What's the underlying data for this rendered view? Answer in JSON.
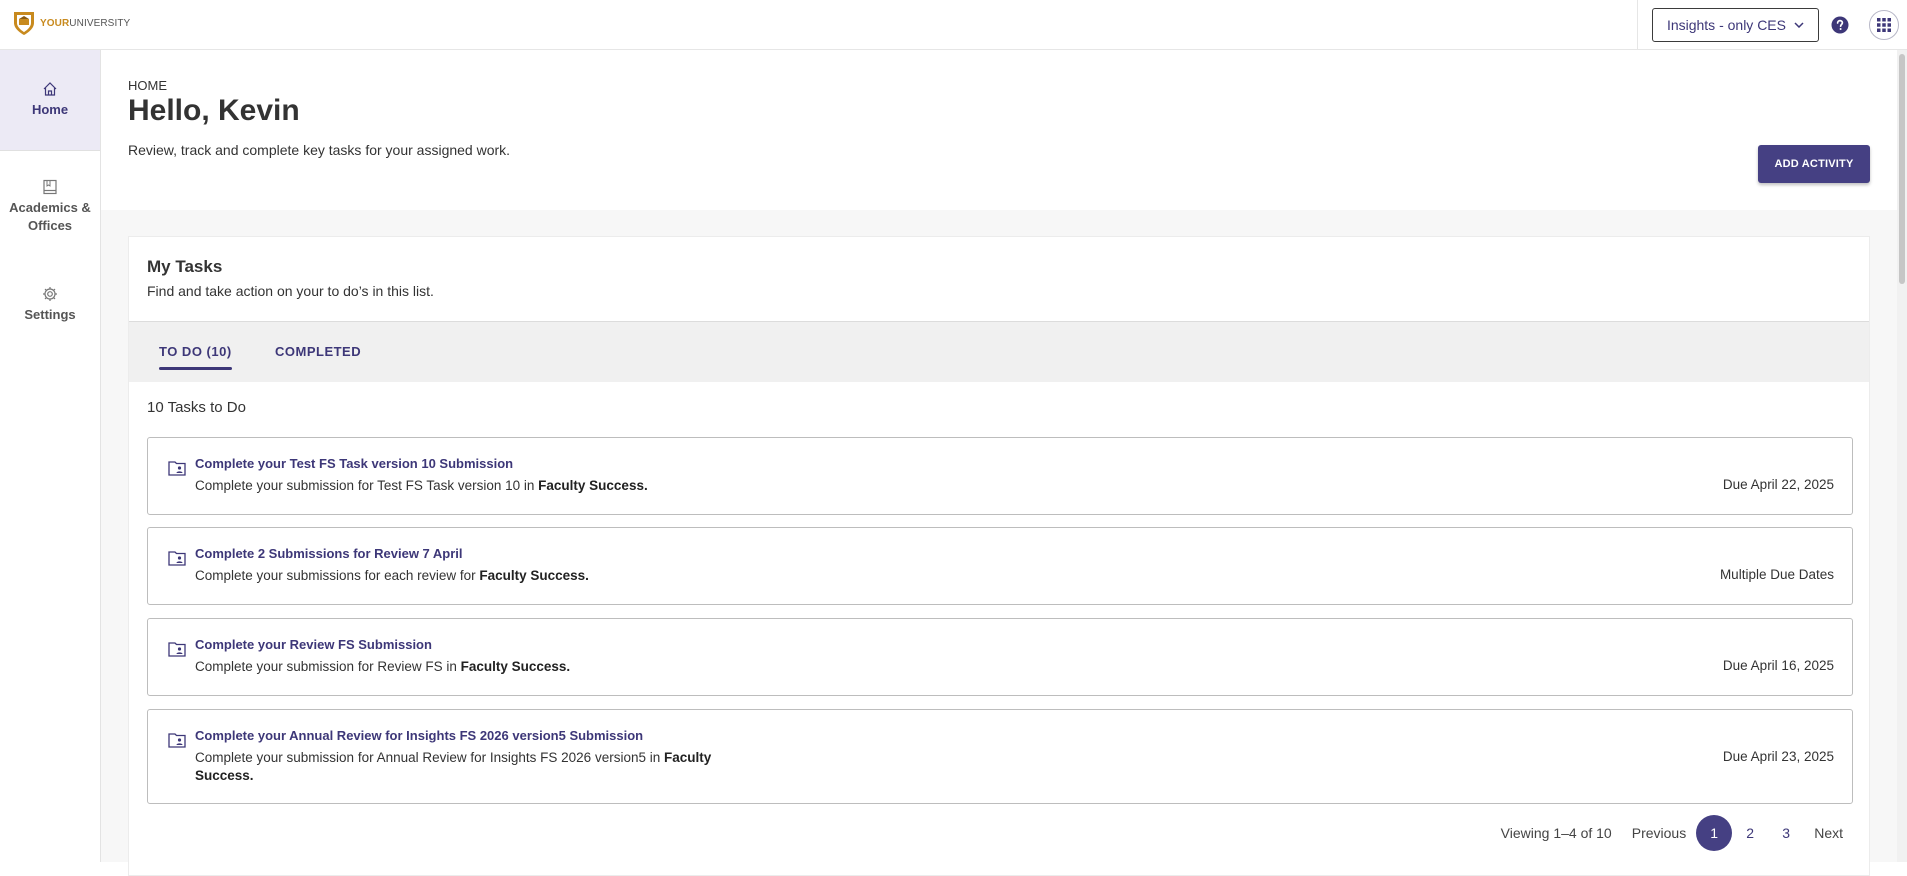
{
  "brand": {
    "prefix": "YOUR",
    "suffix": "UNIVERSITY",
    "color": "#c88a1e"
  },
  "topbar": {
    "selector_label": "Insights - only CES",
    "help_icon": "help-circle-icon",
    "apps_icon": "grid-menu-icon"
  },
  "sidebar": {
    "items": [
      {
        "label": "Home",
        "icon": "home-icon",
        "active": true
      },
      {
        "label": "Academics & Offices",
        "icon": "book-icon",
        "active": false
      },
      {
        "label": "Settings",
        "icon": "gear-icon",
        "active": false
      }
    ]
  },
  "header": {
    "breadcrumb": "HOME",
    "title": "Hello, Kevin",
    "subtitle": "Review, track and complete key tasks for your assigned work.",
    "add_button": "ADD ACTIVITY"
  },
  "tasks_card": {
    "title": "My Tasks",
    "subtitle": "Find and take action on your to do’s in this list.",
    "tabs": [
      {
        "label": "TO DO (10)",
        "active": true
      },
      {
        "label": "COMPLETED",
        "active": false
      }
    ],
    "count_label": "10 Tasks to Do",
    "items": [
      {
        "title": "Complete your Test FS Task version 10 Submission",
        "desc_prefix": "Complete your submission for Test FS Task version 10 in ",
        "desc_bold": "Faculty Success.",
        "due": "Due April 22, 2025"
      },
      {
        "title": "Complete 2 Submissions for Review 7 April",
        "desc_prefix": "Complete your submissions for each review for ",
        "desc_bold": "Faculty Success.",
        "due": "Multiple Due Dates"
      },
      {
        "title": "Complete your Review FS Submission",
        "desc_prefix": "Complete your submission for Review FS in ",
        "desc_bold": "Faculty Success.",
        "due": "Due April 16, 2025"
      },
      {
        "title": "Complete your Annual Review for Insights FS 2026 version5 Submission",
        "desc_prefix": "Complete your submission for Annual Review for Insights FS 2026 version5 in ",
        "desc_bold": "Faculty Success.",
        "due": "Due April 23, 2025"
      }
    ],
    "pagination": {
      "info": "Viewing 1–4 of 10",
      "previous": "Previous",
      "pages": [
        "1",
        "2",
        "3"
      ],
      "current": "1",
      "next": "Next"
    }
  },
  "colors": {
    "accent": "#454083",
    "link": "#3d3778",
    "active_nav_bg": "#eceaf5"
  }
}
